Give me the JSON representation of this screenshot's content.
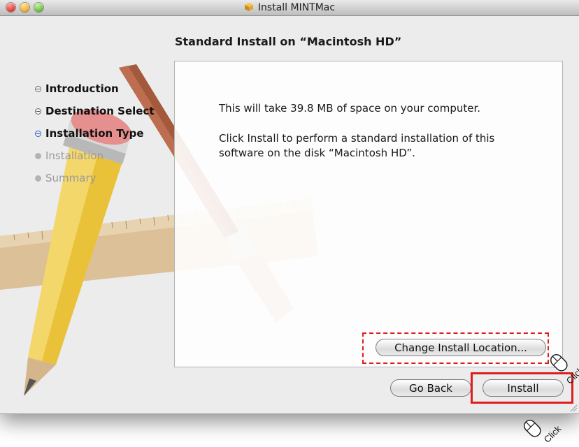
{
  "window": {
    "title": "Install MINTMac",
    "heading": "Standard Install on “Macintosh HD”"
  },
  "steps": [
    {
      "label": "Introduction",
      "state": "done"
    },
    {
      "label": "Destination Select",
      "state": "done"
    },
    {
      "label": "Installation Type",
      "state": "active"
    },
    {
      "label": "Installation",
      "state": "future"
    },
    {
      "label": "Summary",
      "state": "future"
    }
  ],
  "content": {
    "space_message": "This will take 39.8 MB of space on your computer.",
    "install_message": "Click Install to perform a standard installation of this software on the disk “Macintosh HD”."
  },
  "buttons": {
    "change_location": "Change Install Location...",
    "go_back": "Go Back",
    "install": "Install"
  },
  "annotations": {
    "click_label": "Click",
    "highlight_color": "#e01d1d"
  },
  "icons": [
    "close-icon",
    "minimize-icon",
    "zoom-icon",
    "package-icon",
    "mouse-cursor-icon"
  ]
}
